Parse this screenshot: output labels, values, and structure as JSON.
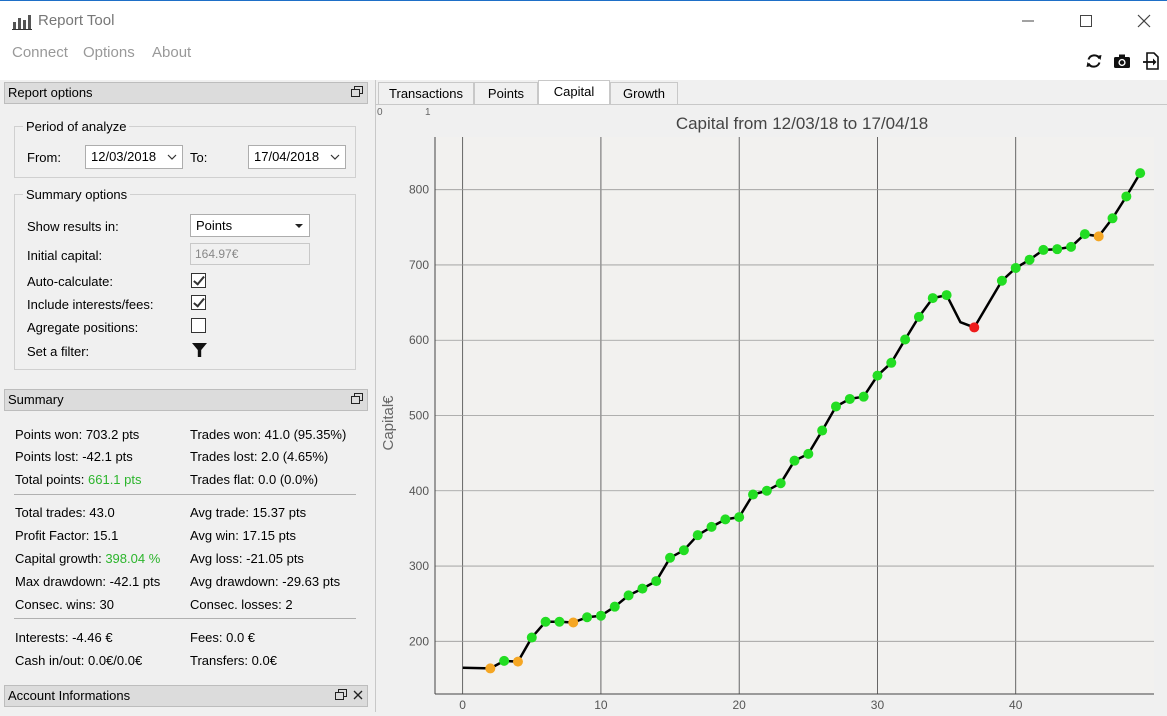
{
  "window": {
    "title": "Report Tool"
  },
  "menu": {
    "items": [
      "Connect",
      "Options",
      "About"
    ]
  },
  "toolbar": {
    "icons": [
      "refresh-icon",
      "camera-icon",
      "export-icon"
    ]
  },
  "report_options": {
    "title": "Report options",
    "period": {
      "title": "Period of analyze",
      "from_label": "From:",
      "from_value": "12/03/2018",
      "to_label": "To:",
      "to_value": "17/04/2018"
    },
    "summary_options": {
      "title": "Summary options",
      "show_results_label": "Show results in:",
      "show_results_value": "Points",
      "initial_capital_label": "Initial capital:",
      "initial_capital_value": "164.97€",
      "auto_calc_label": "Auto-calculate:",
      "auto_calc_checked": true,
      "include_interests_label": "Include interests/fees:",
      "include_interests_checked": true,
      "aggregate_label": "Agregate positions:",
      "aggregate_checked": false,
      "filter_label": "Set a filter:"
    }
  },
  "summary": {
    "title": "Summary",
    "points_won": "Points won: 703.2 pts",
    "points_lost": "Points lost: -42.1 pts",
    "total_points_label": "Total points: ",
    "total_points_value": "661.1 pts",
    "trades_won": "Trades won: 41.0 (95.35%)",
    "trades_lost": "Trades lost: 2.0 (4.65%)",
    "trades_flat": "Trades flat: 0.0 (0.0%)",
    "total_trades": "Total trades: 43.0",
    "profit_factor": "Profit Factor: 15.1",
    "capital_growth_label": "Capital growth: ",
    "capital_growth_value": "398.04 %",
    "max_drawdown": "Max drawdown: -42.1 pts",
    "consec_wins": "Consec. wins: 30",
    "avg_trade": "Avg trade: 15.37 pts",
    "avg_win": "Avg win: 17.15 pts",
    "avg_loss": "Avg loss: -21.05 pts",
    "avg_drawdown": "Avg drawdown: -29.63 pts",
    "consec_losses": "Consec. losses: 2",
    "interests": "Interests: -4.46 €",
    "cash_in_out": "Cash in/out: 0.0€/0.0€",
    "fees": "Fees: 0.0 €",
    "transfers": "Transfers: 0.0€"
  },
  "account_info": {
    "title": "Account Informations"
  },
  "tabs": [
    "Transactions",
    "Points",
    "Capital",
    "Growth"
  ],
  "active_tab": "Capital",
  "ruler": {
    "labels": [
      "0",
      "1"
    ]
  },
  "chart_data": {
    "type": "line",
    "title": "Capital from 12/03/18 to 17/04/18",
    "xlabel": "",
    "ylabel": "Capital€",
    "xlim": [
      -2,
      50
    ],
    "ylim": [
      130,
      870
    ],
    "x_ticks": [
      0,
      10,
      20,
      30,
      40
    ],
    "y_ticks": [
      200,
      300,
      400,
      500,
      600,
      700,
      800
    ],
    "grid": true,
    "line_color": "#000000",
    "marker_colors": {
      "win": "#22dd22",
      "small": "#f5a623",
      "loss": "#ee1c1c"
    },
    "line_points": [
      {
        "x": 0,
        "y": 165
      },
      {
        "x": 2,
        "y": 164
      },
      {
        "x": 3,
        "y": 174
      },
      {
        "x": 4,
        "y": 173
      },
      {
        "x": 5,
        "y": 205
      },
      {
        "x": 6,
        "y": 226
      },
      {
        "x": 7,
        "y": 226
      },
      {
        "x": 8,
        "y": 225
      },
      {
        "x": 9,
        "y": 232
      },
      {
        "x": 10,
        "y": 234
      },
      {
        "x": 11,
        "y": 246
      },
      {
        "x": 12,
        "y": 261
      },
      {
        "x": 13,
        "y": 270
      },
      {
        "x": 14,
        "y": 280
      },
      {
        "x": 15,
        "y": 311
      },
      {
        "x": 16,
        "y": 321
      },
      {
        "x": 17,
        "y": 341
      },
      {
        "x": 18,
        "y": 352
      },
      {
        "x": 19,
        "y": 362
      },
      {
        "x": 20,
        "y": 365
      },
      {
        "x": 21,
        "y": 395
      },
      {
        "x": 22,
        "y": 400
      },
      {
        "x": 23,
        "y": 410
      },
      {
        "x": 24,
        "y": 440
      },
      {
        "x": 25,
        "y": 449
      },
      {
        "x": 26,
        "y": 480
      },
      {
        "x": 27,
        "y": 512
      },
      {
        "x": 28,
        "y": 522
      },
      {
        "x": 29,
        "y": 525
      },
      {
        "x": 30,
        "y": 553
      },
      {
        "x": 31,
        "y": 570
      },
      {
        "x": 32,
        "y": 601
      },
      {
        "x": 33,
        "y": 631
      },
      {
        "x": 34,
        "y": 656
      },
      {
        "x": 35,
        "y": 660
      },
      {
        "x": 36,
        "y": 624
      },
      {
        "x": 37,
        "y": 617
      },
      {
        "x": 39,
        "y": 679
      },
      {
        "x": 40,
        "y": 696
      },
      {
        "x": 41,
        "y": 707
      },
      {
        "x": 42,
        "y": 720
      },
      {
        "x": 43,
        "y": 721
      },
      {
        "x": 44,
        "y": 724
      },
      {
        "x": 45,
        "y": 741
      },
      {
        "x": 46,
        "y": 738
      },
      {
        "x": 47,
        "y": 762
      },
      {
        "x": 48,
        "y": 791
      },
      {
        "x": 49,
        "y": 822
      }
    ],
    "markers": [
      {
        "x": 2,
        "y": 164,
        "c": "small"
      },
      {
        "x": 3,
        "y": 174,
        "c": "win"
      },
      {
        "x": 4,
        "y": 173,
        "c": "small"
      },
      {
        "x": 5,
        "y": 205,
        "c": "win"
      },
      {
        "x": 6,
        "y": 226,
        "c": "win"
      },
      {
        "x": 7,
        "y": 226,
        "c": "win"
      },
      {
        "x": 8,
        "y": 225,
        "c": "small"
      },
      {
        "x": 9,
        "y": 232,
        "c": "win"
      },
      {
        "x": 10,
        "y": 234,
        "c": "win"
      },
      {
        "x": 11,
        "y": 246,
        "c": "win"
      },
      {
        "x": 12,
        "y": 261,
        "c": "win"
      },
      {
        "x": 13,
        "y": 270,
        "c": "win"
      },
      {
        "x": 14,
        "y": 280,
        "c": "win"
      },
      {
        "x": 15,
        "y": 311,
        "c": "win"
      },
      {
        "x": 16,
        "y": 321,
        "c": "win"
      },
      {
        "x": 17,
        "y": 341,
        "c": "win"
      },
      {
        "x": 18,
        "y": 352,
        "c": "win"
      },
      {
        "x": 19,
        "y": 362,
        "c": "win"
      },
      {
        "x": 20,
        "y": 365,
        "c": "win"
      },
      {
        "x": 21,
        "y": 395,
        "c": "win"
      },
      {
        "x": 22,
        "y": 400,
        "c": "win"
      },
      {
        "x": 23,
        "y": 410,
        "c": "win"
      },
      {
        "x": 24,
        "y": 440,
        "c": "win"
      },
      {
        "x": 25,
        "y": 449,
        "c": "win"
      },
      {
        "x": 26,
        "y": 480,
        "c": "win"
      },
      {
        "x": 27,
        "y": 512,
        "c": "win"
      },
      {
        "x": 28,
        "y": 522,
        "c": "win"
      },
      {
        "x": 29,
        "y": 525,
        "c": "win"
      },
      {
        "x": 30,
        "y": 553,
        "c": "win"
      },
      {
        "x": 31,
        "y": 570,
        "c": "win"
      },
      {
        "x": 32,
        "y": 601,
        "c": "win"
      },
      {
        "x": 33,
        "y": 631,
        "c": "win"
      },
      {
        "x": 34,
        "y": 656,
        "c": "win"
      },
      {
        "x": 35,
        "y": 660,
        "c": "win"
      },
      {
        "x": 37,
        "y": 617,
        "c": "loss"
      },
      {
        "x": 39,
        "y": 679,
        "c": "win"
      },
      {
        "x": 40,
        "y": 696,
        "c": "win"
      },
      {
        "x": 41,
        "y": 707,
        "c": "win"
      },
      {
        "x": 42,
        "y": 720,
        "c": "win"
      },
      {
        "x": 43,
        "y": 721,
        "c": "win"
      },
      {
        "x": 44,
        "y": 724,
        "c": "win"
      },
      {
        "x": 45,
        "y": 741,
        "c": "win"
      },
      {
        "x": 46,
        "y": 738,
        "c": "small"
      },
      {
        "x": 47,
        "y": 762,
        "c": "win"
      },
      {
        "x": 48,
        "y": 791,
        "c": "win"
      },
      {
        "x": 49,
        "y": 822,
        "c": "win"
      }
    ]
  }
}
